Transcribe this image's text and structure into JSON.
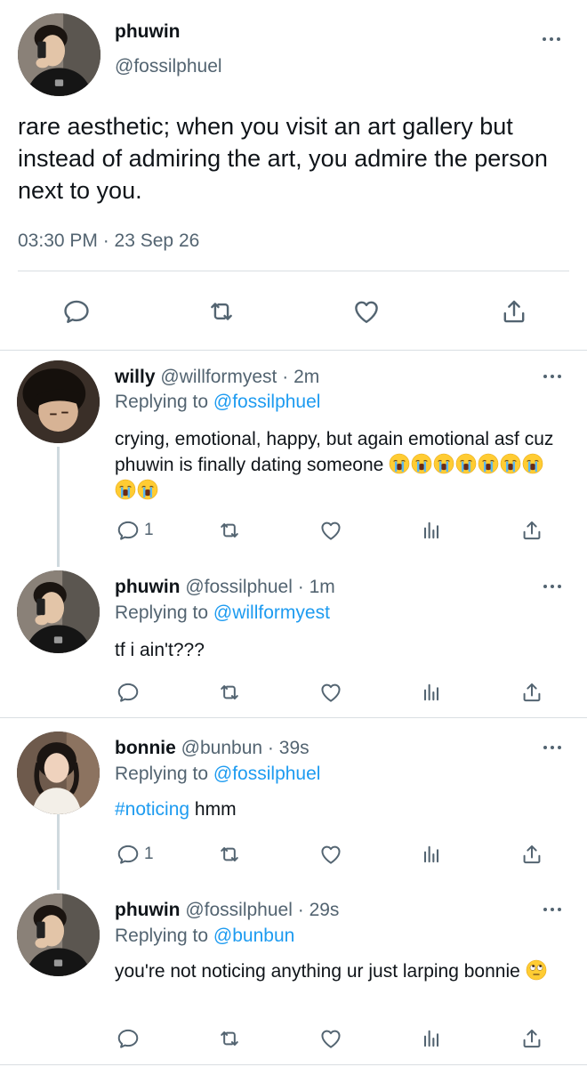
{
  "main_tweet": {
    "name": "phuwin",
    "handle": "@fossilphuel",
    "text": "rare aesthetic; when you visit an art gallery but instead of admiring the art, you admire the person next to you.",
    "timestamp": "03:30 PM · 23 Sep 26",
    "actions": [
      "reply-icon",
      "retweet-icon",
      "like-icon",
      "share-icon"
    ]
  },
  "replies": [
    {
      "name": "willy",
      "handle": "@willformyest",
      "dot": "·",
      "time": "2m",
      "replying_prefix": "Replying to ",
      "replying_to": "@fossilphuel",
      "text": "crying, emotional, happy, but again emotional asf cuz phuwin is finally dating someone",
      "emoji": "loudly-crying-face",
      "emoji_count": 9,
      "reply_count": "1"
    },
    {
      "name": "phuwin",
      "handle": "@fossilphuel",
      "dot": "·",
      "time": "1m",
      "replying_prefix": "Replying to ",
      "replying_to": "@willformyest",
      "text": "tf i ain't???",
      "reply_count": ""
    },
    {
      "name": "bonnie",
      "handle": "@bunbun",
      "dot": "·",
      "time": "39s",
      "replying_prefix": "Replying to ",
      "replying_to": "@fossilphuel",
      "hashtag": "#noticing",
      "text": " hmm",
      "reply_count": "1"
    },
    {
      "name": "phuwin",
      "handle": "@fossilphuel",
      "dot": "·",
      "time": "29s",
      "replying_prefix": "Replying to ",
      "replying_to": "@bunbun",
      "text": "you're not noticing anything ur just larping bonnie",
      "emoji": "face-with-rolling-eyes",
      "reply_count": ""
    }
  ],
  "colors": {
    "text": "#0f1419",
    "secondary": "#536471",
    "link": "#1d9bf0",
    "divider": "#d9dee2"
  }
}
